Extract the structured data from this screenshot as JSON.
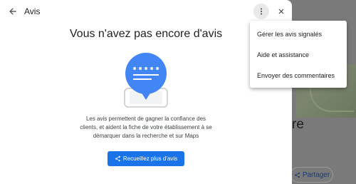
{
  "header": {
    "title": "Avis",
    "back_icon": "arrow-back-icon",
    "more_icon": "more-vert-icon",
    "close_icon": "close-icon"
  },
  "empty_state": {
    "heading": "Vous n'avez pas encore d'avis",
    "illustration_icon": "review-speech-bubble-icon",
    "description": "Les avis permettent de gagner la confiance des clients, et aident la fiche de votre établissement à se démarquer dans la recherche et sur Maps",
    "cta_label": "Recueillez plus d'avis",
    "cta_icon": "share-icon"
  },
  "menu": {
    "items": [
      {
        "label": "Gérer les avis signalés"
      },
      {
        "label": "Aide et assistance"
      },
      {
        "label": "Envoyer des commentaires"
      }
    ]
  },
  "background": {
    "letter": "re",
    "share_label": "Partager"
  },
  "colors": {
    "accent": "#1a73e8",
    "overlay": "#7a7a7a",
    "text": "#202124"
  }
}
